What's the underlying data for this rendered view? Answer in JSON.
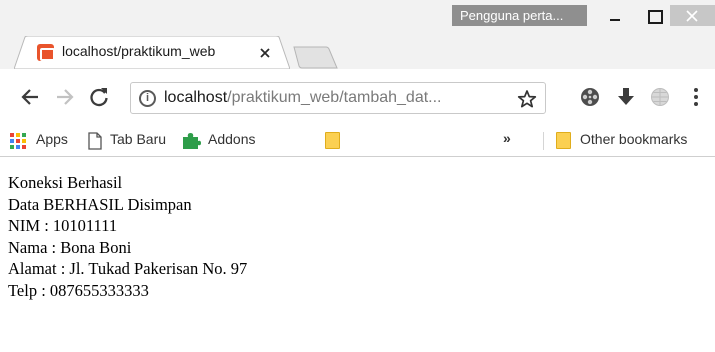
{
  "window": {
    "profile_label": "Pengguna perta...",
    "controls": [
      "minimize-icon",
      "maximize-icon",
      "close-icon"
    ]
  },
  "tab": {
    "title": "localhost/praktikum_web",
    "favicon": "xampp-icon",
    "close_icon": "close-icon"
  },
  "toolbar": {
    "nav_icons": [
      "back-arrow-icon",
      "forward-arrow-icon",
      "reload-icon"
    ],
    "address": {
      "host": "localhost",
      "path": "/praktikum_web/tambah_dat...",
      "security_icon": "info-icon"
    },
    "extension_icons": [
      "star-icon",
      "film-reel-icon",
      "download-icon",
      "globe-icon",
      "more-vertical-icon"
    ]
  },
  "bookmarks": {
    "items": [
      {
        "label": "Apps",
        "icon": "apps-grid-icon"
      },
      {
        "label": "Tab Baru",
        "icon": "page-icon"
      },
      {
        "label": "Addons",
        "icon": "puzzle-icon"
      },
      {
        "label": "",
        "icon": "folder-icon"
      }
    ],
    "overflow": "»",
    "other": {
      "label": "Other bookmarks",
      "icon": "folder-icon"
    }
  },
  "content": {
    "lines": [
      "Koneksi Berhasil",
      "Data BERHASIL Disimpan",
      "NIM : 10101111",
      "Nama : Bona Boni",
      "Alamat : Jl. Tukad Pakerisan No. 97",
      "Telp : 087655333333"
    ]
  },
  "colors": {
    "chrome_frame": "#f2f2f2",
    "profile_chip": "#8f8f8f",
    "favicon": "#e9542c",
    "folder": "#fbd052",
    "puzzle": "#2e9d4a"
  }
}
